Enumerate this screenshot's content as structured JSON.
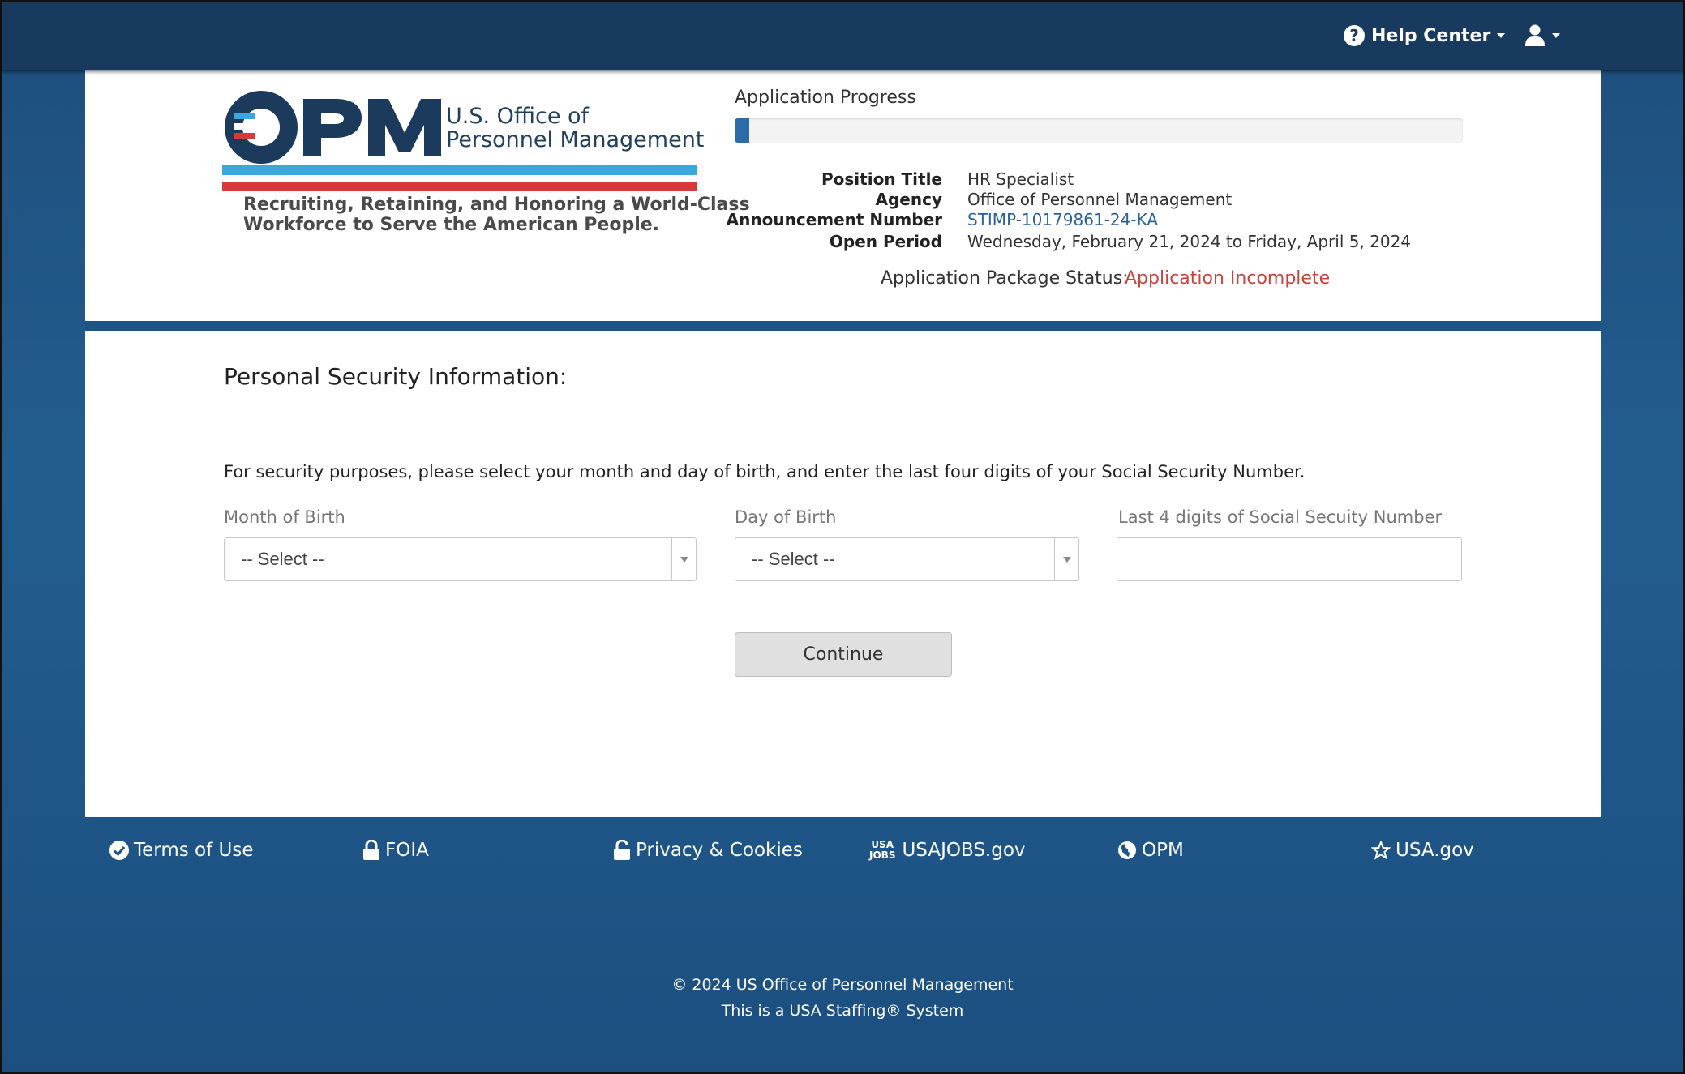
{
  "topbar": {
    "help_center_label": "Help Center",
    "help_icon": "question-circle-icon",
    "user_icon": "user-icon"
  },
  "logo": {
    "letters": "OPM",
    "line1": "U.S. Office of",
    "line2": "Personnel Management",
    "tagline1": "Recruiting, Retaining, and Honoring a World-Class",
    "tagline2": "Workforce to Serve the American People."
  },
  "progress": {
    "label": "Application Progress",
    "percent": 2
  },
  "position": {
    "title_label": "Position Title",
    "title_value": "HR Specialist",
    "agency_label": "Agency",
    "agency_value": "Office of Personnel Management",
    "announcement_label": "Announcement Number",
    "announcement_value": "STIMP-10179861-24-KA",
    "open_period_label": "Open Period",
    "open_period_value": "Wednesday, February 21, 2024 to Friday, April 5, 2024"
  },
  "status": {
    "label": "Application Package Status:",
    "value": "Application Incomplete",
    "color": "#c9433a"
  },
  "form": {
    "section_title": "Personal Security Information:",
    "instructions": "For security purposes, please select your month and day of birth, and enter the last four digits of your Social Security Number.",
    "month_label": "Month of Birth",
    "month_value": "-- Select --",
    "day_label": "Day of Birth",
    "day_value": "-- Select --",
    "ssn_label": "Last 4 digits of Social Secuity Number",
    "ssn_value": "",
    "continue_label": "Continue"
  },
  "footer": {
    "links": [
      {
        "label": "Terms of Use",
        "icon": "check-circle-icon"
      },
      {
        "label": "FOIA",
        "icon": "lock-icon"
      },
      {
        "label": "Privacy & Cookies",
        "icon": "lock-open-icon"
      },
      {
        "label": "USAJOBS.gov",
        "icon": "usajobs-logo-icon",
        "mark_top": "USA",
        "mark_bottom": "JOBS"
      },
      {
        "label": "OPM",
        "icon": "globe-icon"
      },
      {
        "label": "USA.gov",
        "icon": "star-outline-icon"
      }
    ],
    "copyright": "© 2024 US Office of Personnel Management",
    "system": "This is a USA Staffing® System"
  },
  "colors": {
    "topbar": "#173a5e",
    "background": "#1f5586",
    "accent_blue": "#2d6ba8",
    "logo_navy": "#1b3a5c",
    "logo_red": "#d63b3b",
    "logo_lightblue": "#3aa8dc"
  }
}
